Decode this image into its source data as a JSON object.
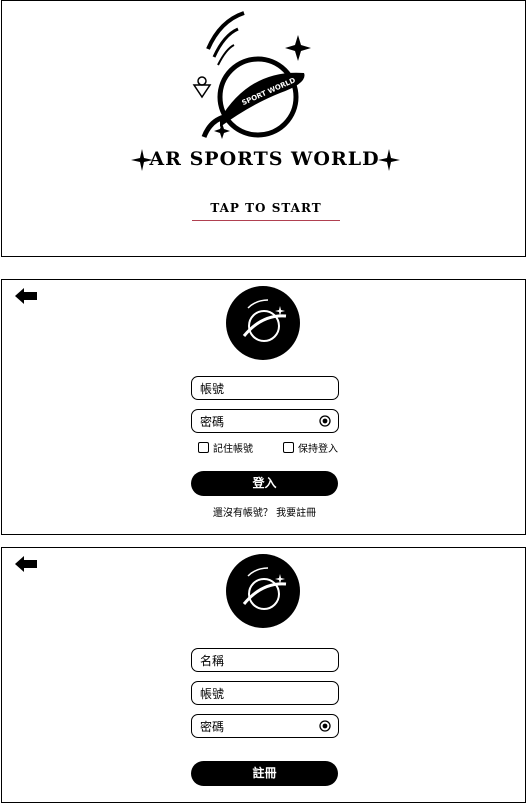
{
  "start": {
    "title": "AR SPORTS WORLD",
    "logo_banner": "SPORT WORLD",
    "tap_label": "TAP TO START"
  },
  "login": {
    "account_placeholder": "帳號",
    "password_placeholder": "密碼",
    "remember_label": "記住帳號",
    "keep_login_label": "保持登入",
    "login_button": "登入",
    "no_account_text": "還沒有帳號？",
    "register_link": "我要註冊"
  },
  "register": {
    "name_placeholder": "名稱",
    "account_placeholder": "帳號",
    "password_placeholder": "密碼",
    "register_button": "註冊"
  },
  "colors": {
    "primary": "#000000",
    "accent_underline": "#b04050",
    "background": "#ffffff"
  }
}
